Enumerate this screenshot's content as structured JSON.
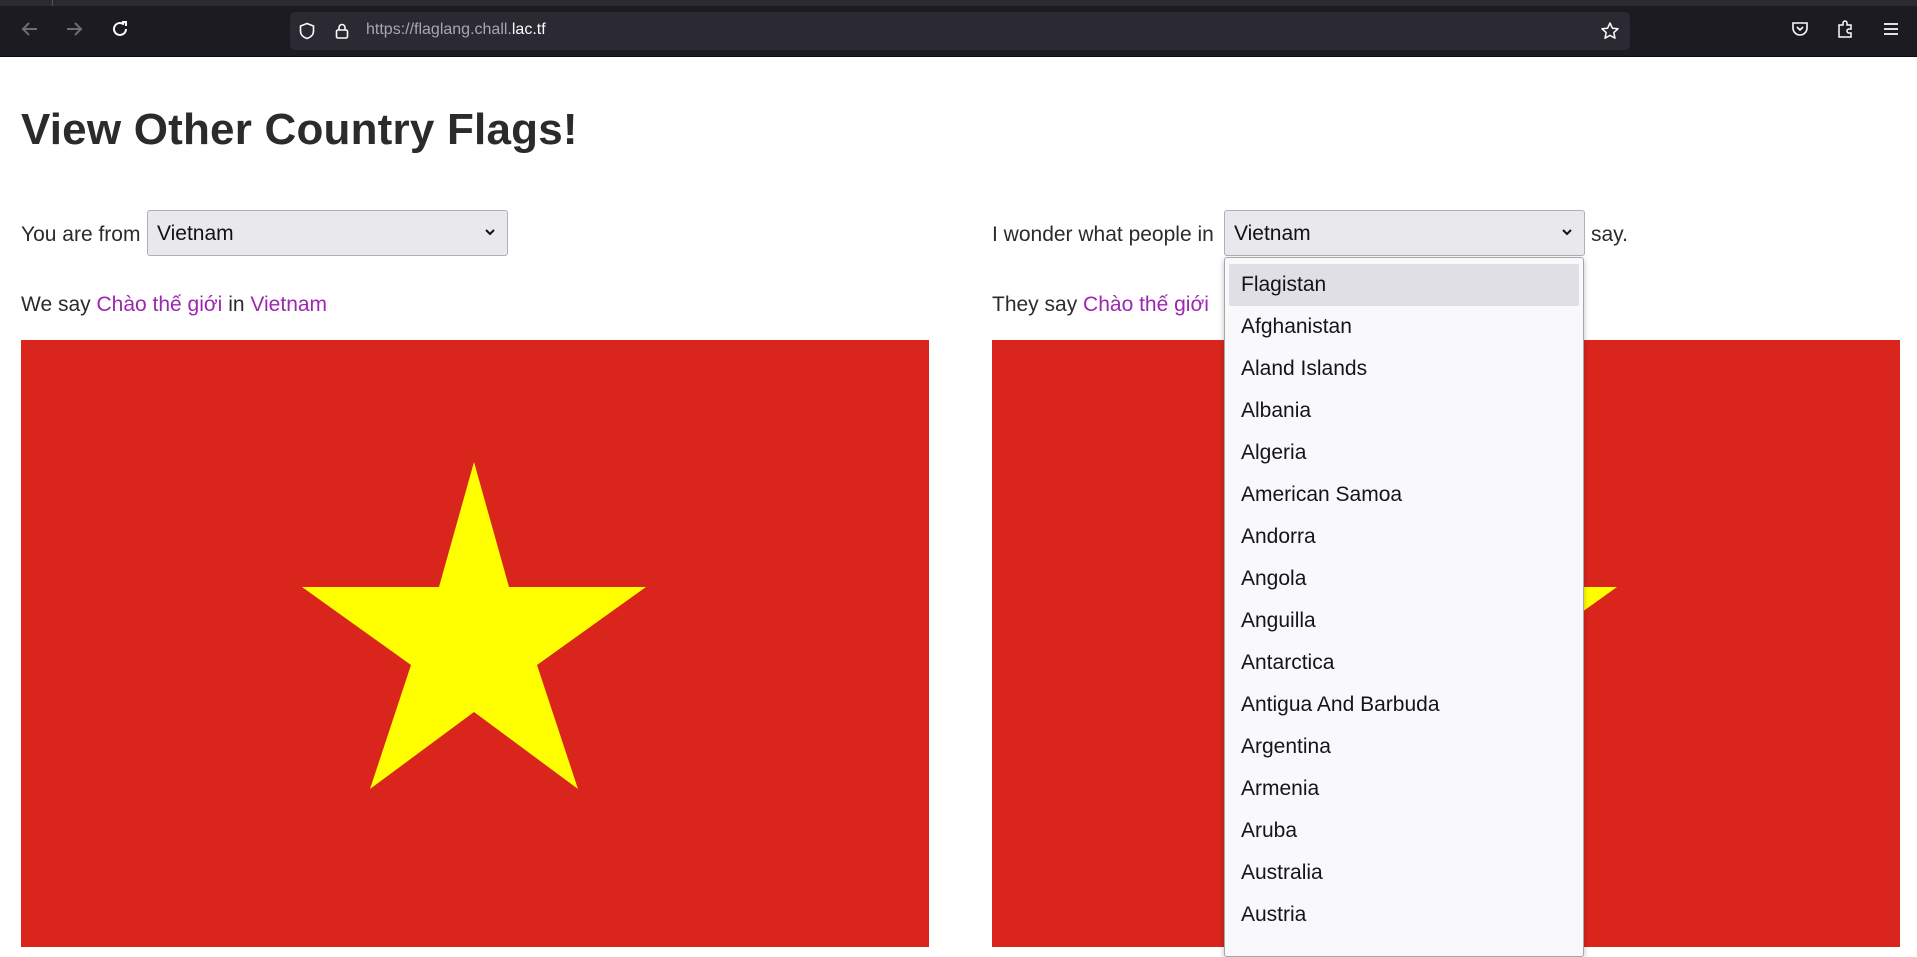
{
  "browser": {
    "url_prefix": "https://flaglang.chall.",
    "url_domain": "lac.tf"
  },
  "page": {
    "title": "View Other Country Flags!"
  },
  "left": {
    "from_label": "You are from",
    "selected_country": "Vietnam",
    "we_say": "We say",
    "greeting": "Chào thế giới",
    "in_word": "in",
    "country_link": "Vietnam"
  },
  "right": {
    "wonder_label": "I wonder what people in",
    "selected_country": "Vietnam",
    "say_suffix": "say.",
    "they_say": "They say",
    "greeting": "Chào thế giới"
  },
  "dropdown": {
    "options": [
      "Flagistan",
      "Afghanistan",
      "Aland Islands",
      "Albania",
      "Algeria",
      "American Samoa",
      "Andorra",
      "Angola",
      "Anguilla",
      "Antarctica",
      "Antigua And Barbuda",
      "Argentina",
      "Armenia",
      "Aruba",
      "Australia",
      "Austria"
    ],
    "highlighted": "Flagistan"
  },
  "colors": {
    "flag_red": "#da251d",
    "flag_star": "#ffff00",
    "link": "#9c27b0",
    "chrome_bg": "#1c1b22"
  },
  "icons": {
    "back": "arrow-left-icon",
    "forward": "arrow-right-icon",
    "reload": "reload-icon",
    "shield": "shield-icon",
    "lock": "lock-icon",
    "bookmark": "star-icon",
    "pocket": "pocket-icon",
    "extensions": "puzzle-icon",
    "menu": "hamburger-menu-icon"
  }
}
